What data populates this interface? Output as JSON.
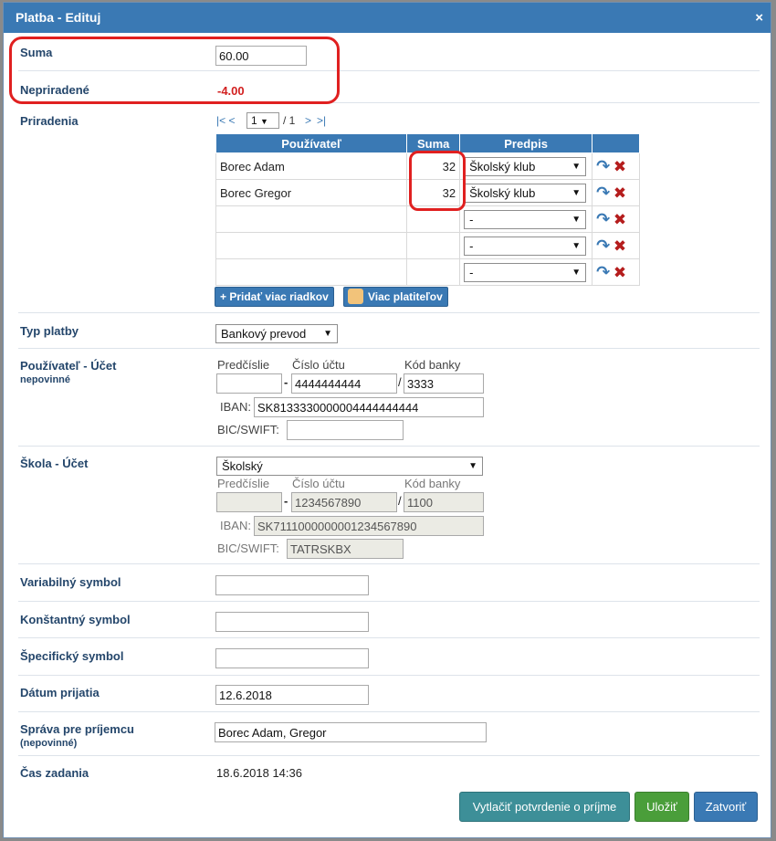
{
  "dialog": {
    "title": "Platba - Edituj",
    "close_icon": "×"
  },
  "suma": {
    "label": "Suma",
    "value": "60.00"
  },
  "nepriradene": {
    "label": "Nepriradené",
    "value": "-4.00"
  },
  "priradenia": {
    "label": "Priradenia",
    "pager": {
      "first": "|<",
      "prev": "<",
      "page": "1",
      "sep": "/ 1",
      "next": ">",
      "last": ">|"
    },
    "headers": [
      "Používateľ",
      "Suma",
      "Predpis"
    ],
    "rows": [
      {
        "user": "Borec Adam",
        "amount": "32",
        "predpis": "Školský klub"
      },
      {
        "user": "Borec Gregor",
        "amount": "32",
        "predpis": "Školský klub"
      },
      {
        "user": "",
        "amount": "",
        "predpis": "-"
      },
      {
        "user": "",
        "amount": "",
        "predpis": "-"
      },
      {
        "user": "",
        "amount": "",
        "predpis": "-"
      }
    ],
    "add_rows_button": "+ Pridať viac riadkov",
    "more_payers_button": "Viac platiteľov"
  },
  "typ_platby": {
    "label": "Typ platby",
    "value": "Bankový prevod"
  },
  "pouzivatel_ucet": {
    "label": "Používateľ - Účet",
    "sublabel": "nepovinné",
    "predcislie_label": "Predčíslie",
    "cislo_label": "Číslo účtu",
    "kod_label": "Kód banky",
    "predcislie": "",
    "cislo": "4444444444",
    "kod": "3333",
    "iban_label": "IBAN:",
    "iban": "SK8133330000004444444444",
    "bic_label": "BIC/SWIFT:",
    "bic": ""
  },
  "skola_ucet": {
    "label": "Škola - Účet",
    "select": "Školský",
    "predcislie_label": "Predčíslie",
    "cislo_label": "Číslo účtu",
    "kod_label": "Kód banky",
    "predcislie": "",
    "cislo": "1234567890",
    "kod": "1100",
    "iban_label": "IBAN:",
    "iban": "SK7111000000001234567890",
    "bic_label": "BIC/SWIFT:",
    "bic": "TATRSKBX"
  },
  "variabilny": {
    "label": "Variabilný symbol",
    "value": ""
  },
  "konstantny": {
    "label": "Konštantný symbol",
    "value": ""
  },
  "specificky": {
    "label": "Špecifický symbol",
    "value": ""
  },
  "datum": {
    "label": "Dátum prijatia",
    "value": "12.6.2018"
  },
  "sprava": {
    "label": "Správa pre príjemcu",
    "sublabel": "(nepovinné)",
    "value": "Borec Adam, Gregor"
  },
  "cas": {
    "label": "Čas zadania",
    "value": "18.6.2018 14:36"
  },
  "footer": {
    "print": "Vytlačiť potvrdenie o príjme",
    "save": "Uložiť",
    "close": "Zatvoriť"
  },
  "colors": {
    "primary": "#3a79b4",
    "teal": "#3d8f98",
    "green": "#4a9e3a",
    "danger": "#d21f1f"
  }
}
